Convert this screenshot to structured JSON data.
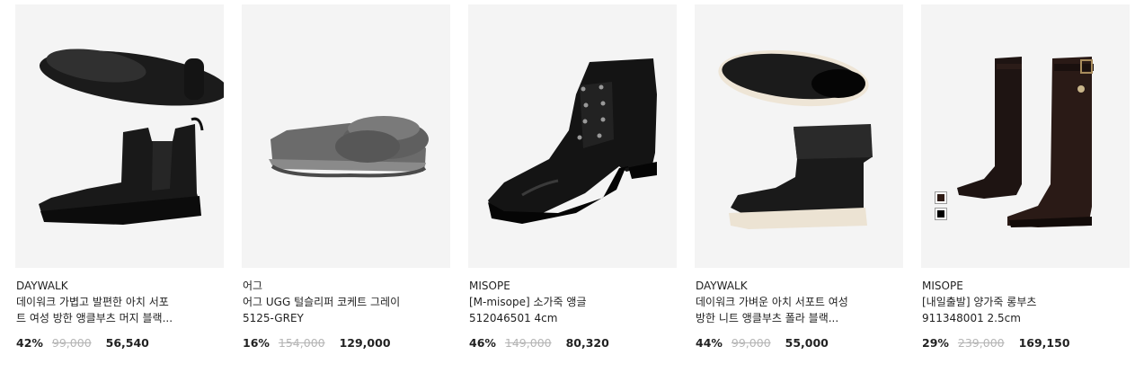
{
  "products": [
    {
      "brand": "DAYWALK",
      "title_line1": "데이워크 가볍고 발편한 아치 서포",
      "title_line2": "트 여성 방한 앵클부츠 머지 블랙...",
      "discount": "42%",
      "original_price": "99,000",
      "sale_price": "56,540",
      "image_icon": "black-knit-chelsea-boot-image"
    },
    {
      "brand": "어그",
      "title_line1": "어그 UGG 털슬리퍼 코케트 그레이",
      "title_line2": "5125-GREY",
      "discount": "16%",
      "original_price": "154,000",
      "sale_price": "129,000",
      "image_icon": "grey-fur-slipper-image"
    },
    {
      "brand": "MISOPE",
      "title_line1": "[M-misope] 소가죽 앵글",
      "title_line2": "512046501 4cm",
      "discount": "46%",
      "original_price": "149,000",
      "sale_price": "80,320",
      "image_icon": "black-lace-up-ankle-boot-image"
    },
    {
      "brand": "DAYWALK",
      "title_line1": "데이워크 가벼운 아치 서포트 여성",
      "title_line2": "방한 니트 앵클부츠 폴라 블랙...",
      "discount": "44%",
      "original_price": "99,000",
      "sale_price": "55,000",
      "image_icon": "black-knit-sock-boot-image"
    },
    {
      "brand": "MISOPE",
      "title_line1": "[내일출발] 양가죽 롱부츠",
      "title_line2": "911348001 2.5cm",
      "discount": "29%",
      "original_price": "239,000",
      "sale_price": "169,150",
      "image_icon": "dark-brown-long-boot-image",
      "color_swatches": [
        {
          "name": "brown-swatch",
          "color": "#2e1a14"
        },
        {
          "name": "black-swatch",
          "color": "#000000"
        }
      ]
    }
  ],
  "colors": {
    "card_background": "#f4f4f4",
    "strikethrough_price": "#b5b5b5",
    "text": "#222222"
  }
}
